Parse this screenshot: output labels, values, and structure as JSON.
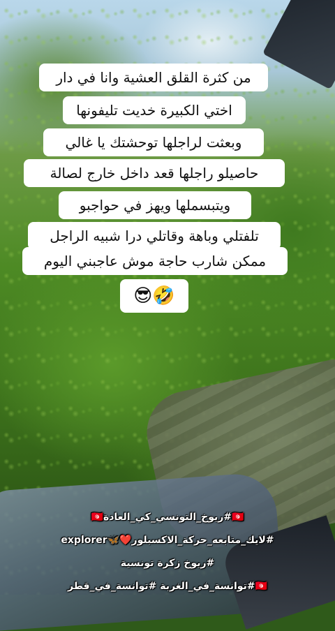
{
  "caption": {
    "lines": [
      "من كثرة القلق العشية وانا في دار",
      "اختي الكبيرة خديت تليفونها",
      "وبعثت لراجلها توحشتك يا غالي",
      "حاصيلو راجلها قعد داخل خارج لصالة",
      "ويتبسملها ويهز في حواجبو",
      "تلفتلي وباهة وقاتلي درا شبيه الراجل",
      "ممكن شارب حاجة موش عاجبني اليوم",
      "😎🤣"
    ]
  },
  "hashtags": [
    "🇹🇳#ريوخ_التونسي_كي_العادة🇹🇳",
    "#لايك_متابعه_حركة_الاكسبلور❤️🦋explorer",
    "#ريوخ زكرة تونسية",
    "🇹🇳#توانسة_في_الغربة #توانسة_في_قطر"
  ]
}
